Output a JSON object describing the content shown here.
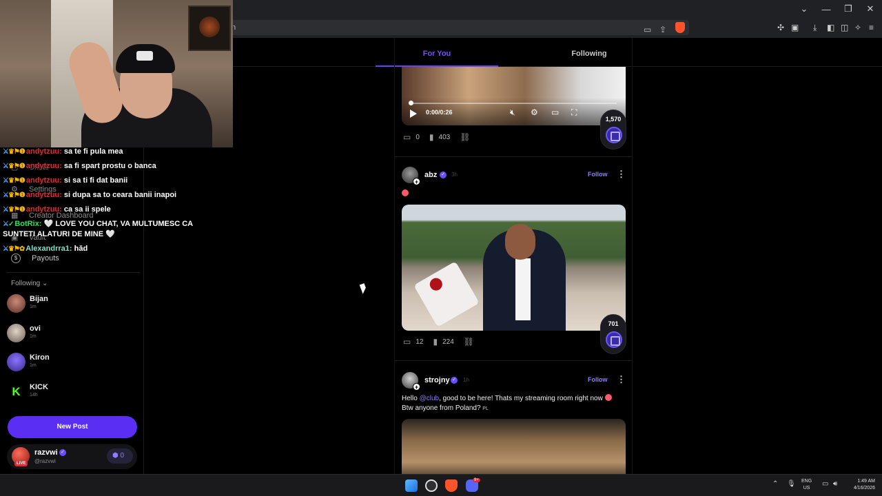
{
  "window": {
    "controls": [
      "⌄",
      "—",
      "❐",
      "✕"
    ],
    "url_fragment": "n"
  },
  "topnav": {
    "tabs": [
      {
        "label": "For You",
        "active": true
      },
      {
        "label": "Following",
        "active": false
      }
    ]
  },
  "sidebar": {
    "ghost_nav": [
      "Chats",
      "Settings",
      "Creator Dashboard",
      "Vault"
    ],
    "payouts_label": "Payouts",
    "following_header": "Following",
    "following": [
      {
        "name": "Bijan",
        "time": "1m"
      },
      {
        "name": "ovi",
        "time": "1m"
      },
      {
        "name": "Kiron",
        "time": "1m"
      },
      {
        "name": "KICK",
        "time": "14h"
      }
    ],
    "new_post_label": "New Post",
    "me": {
      "name": "razvwi",
      "handle": "@razvwi",
      "live": "LIVE",
      "balance": "0"
    }
  },
  "chat": [
    {
      "user": "andytzuu:",
      "msg": "sa te fi pula mea",
      "color": "red"
    },
    {
      "user": "andytzuu:",
      "msg": "sa fi spart prostu o banca",
      "color": "red"
    },
    {
      "user": "andytzuu:",
      "msg": "si sa ti fi dat banii",
      "color": "red"
    },
    {
      "user": "andytzuu:",
      "msg": "si dupa sa to ceara banii inapoi",
      "color": "red"
    },
    {
      "user": "andytzuu:",
      "msg": "ca sa ii spele",
      "color": "red"
    },
    {
      "user": "BotRix:",
      "msg": "🤍 LOVE YOU CHAT, VA MULTUMESC CA SUNTETI ALATURI DE MINE 🤍",
      "color": "green"
    },
    {
      "user": "Alexandrra1:",
      "msg": "hăd",
      "color": "teal"
    }
  ],
  "feed": {
    "post1": {
      "video_time": "0:00/0:26",
      "comments": "0",
      "views": "403",
      "coins": "1,570"
    },
    "post2": {
      "author": "abz",
      "ago": "3h",
      "follow_label": "Follow",
      "comments": "12",
      "views": "224",
      "coins": "701"
    },
    "post3": {
      "author": "strojny",
      "ago": "1h",
      "follow_label": "Follow",
      "text_before": "Hello ",
      "mention": "@club",
      "text_after": ", good to be here! Thats my streaming room right now",
      "text_line2": "Btw anyone from Poland?",
      "flag": "PL"
    }
  },
  "taskbar": {
    "discord_badge": "9+",
    "lang_1": "ENG",
    "lang_2": "US",
    "time": "1:49 AM",
    "date": "4/16/2026"
  },
  "colors": {
    "accent": "#6b3dff",
    "link": "#8f7dff",
    "kick_green": "#53fc18"
  }
}
